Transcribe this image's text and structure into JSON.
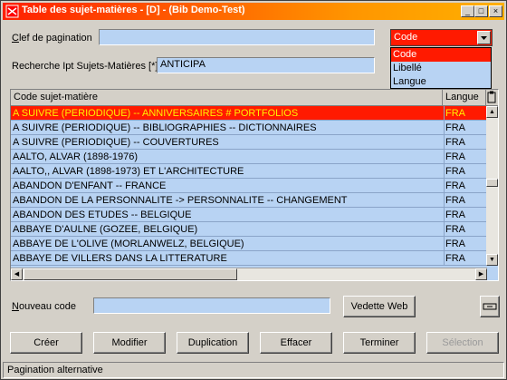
{
  "window": {
    "title": "Table des sujet-matières - [D] - (Bib Demo-Test)",
    "minimize_label": "_",
    "maximize_label": "□",
    "close_label": "×"
  },
  "form": {
    "pagination_key_label": "Clef de pagination",
    "pagination_key_value": "",
    "search_label": "Recherche Ipt Sujets-Matières [*]",
    "search_value": "ANTICIPA",
    "sort_combo_value": "Code",
    "sort_options": [
      "Code",
      "Libellé",
      "Langue"
    ],
    "new_code_label": "Nouveau code",
    "new_code_value": ""
  },
  "table": {
    "columns": [
      "Code sujet-matière",
      "Langue"
    ],
    "rows": [
      {
        "code": "A SUIVRE (PERIODIQUE) -- ANNIVERSAIRES # PORTFOLIOS",
        "lang": "FRA"
      },
      {
        "code": "A SUIVRE (PERIODIQUE) -- BIBLIOGRAPHIES -- DICTIONNAIRES",
        "lang": "FRA"
      },
      {
        "code": "A SUIVRE (PERIODIQUE) -- COUVERTURES",
        "lang": "FRA"
      },
      {
        "code": "AALTO, ALVAR (1898-1976)",
        "lang": "FRA"
      },
      {
        "code": "AALTO,, ALVAR (1898-1973) ET L'ARCHITECTURE",
        "lang": "FRA"
      },
      {
        "code": "ABANDON D'ENFANT -- FRANCE",
        "lang": "FRA"
      },
      {
        "code": "ABANDON DE LA PERSONNALITE -> PERSONNALITE -- CHANGEMENT",
        "lang": "FRA"
      },
      {
        "code": "ABANDON DES ETUDES -- BELGIQUE",
        "lang": "FRA"
      },
      {
        "code": "ABBAYE D'AULNE (GOZEE, BELGIQUE)",
        "lang": "FRA"
      },
      {
        "code": "ABBAYE DE L'OLIVE (MORLANWELZ, BELGIQUE)",
        "lang": "FRA"
      },
      {
        "code": "ABBAYE DE VILLERS DANS LA LITTERATURE",
        "lang": "FRA"
      }
    ]
  },
  "buttons": {
    "vedette_web": "Vedette Web",
    "creer": "Créer",
    "modifier": "Modifier",
    "duplication": "Duplication",
    "effacer": "Effacer",
    "terminer": "Terminer",
    "selection": "Sélection"
  },
  "status": {
    "text": "Pagination alternative"
  },
  "colors": {
    "title_gradient_start": "#ff2000",
    "selection_red": "#ff1a00",
    "field_blue": "#b8d3f3"
  }
}
